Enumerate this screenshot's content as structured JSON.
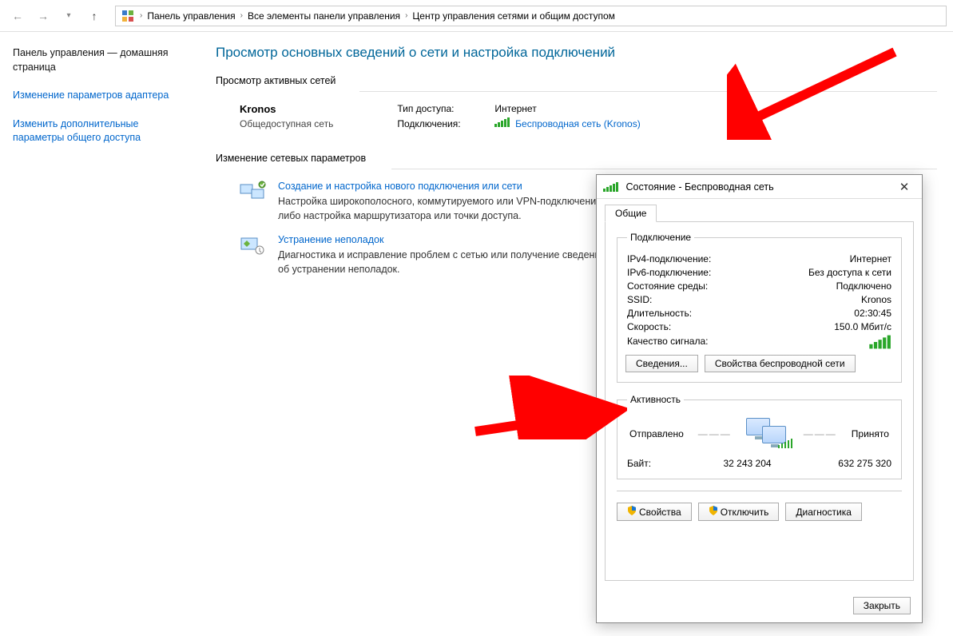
{
  "breadcrumb": {
    "items": [
      "Панель управления",
      "Все элементы панели управления",
      "Центр управления сетями и общим доступом"
    ]
  },
  "sidebar": {
    "items": [
      "Панель управления — домашняя страница",
      "Изменение параметров адаптера",
      "Изменить дополнительные параметры общего доступа"
    ]
  },
  "page": {
    "title": "Просмотр основных сведений о сети и настройка подключений",
    "active_networks_label": "Просмотр активных сетей",
    "change_params_label": "Изменение сетевых параметров"
  },
  "network": {
    "name": "Kronos",
    "profile": "Общедоступная сеть",
    "access_type_label": "Тип доступа:",
    "access_type_value": "Интернет",
    "connections_label": "Подключения:",
    "connection_link": "Беспроводная сеть (Kronos)"
  },
  "setup": {
    "create": {
      "title": "Создание и настройка нового подключения или сети",
      "desc": "Настройка широкополосного, коммутируемого или VPN-подключения либо настройка маршрутизатора или точки доступа."
    },
    "troubleshoot": {
      "title": "Устранение неполадок",
      "desc": "Диагностика и исправление проблем с сетью или получение сведений об устранении неполадок."
    }
  },
  "dialog": {
    "title": "Состояние - Беспроводная сеть",
    "tab": "Общие",
    "group_connection": "Подключение",
    "rows": {
      "ipv4_k": "IPv4-подключение:",
      "ipv4_v": "Интернет",
      "ipv6_k": "IPv6-подключение:",
      "ipv6_v": "Без доступа к сети",
      "media_k": "Состояние среды:",
      "media_v": "Подключено",
      "ssid_k": "SSID:",
      "ssid_v": "Kronos",
      "duration_k": "Длительность:",
      "duration_v": "02:30:45",
      "speed_k": "Скорость:",
      "speed_v": "150.0 Мбит/с",
      "signal_k": "Качество сигнала:"
    },
    "btn_details": "Сведения...",
    "btn_wprops": "Свойства беспроводной сети",
    "group_activity": "Активность",
    "sent_label": "Отправлено",
    "recv_label": "Принято",
    "bytes_label": "Байт:",
    "bytes_sent": "32 243 204",
    "bytes_recv": "632 275 320",
    "btn_props": "Свойства",
    "btn_disable": "Отключить",
    "btn_diag": "Диагностика",
    "btn_close": "Закрыть"
  }
}
